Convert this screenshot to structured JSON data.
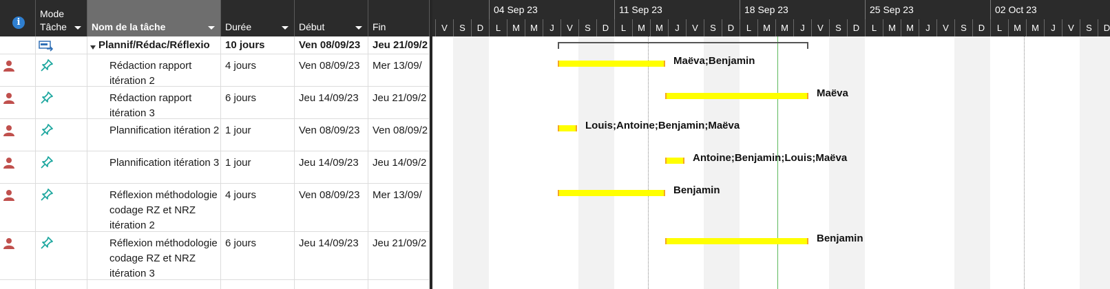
{
  "headers": {
    "mode_line1": "Mode",
    "mode_line2": "Tâche",
    "name": "Nom de la tâche",
    "duration": "Durée",
    "start": "Début",
    "end": "Fin"
  },
  "timeline": {
    "weeks": [
      "04 Sep 23",
      "11 Sep 23",
      "18 Sep 23",
      "25 Sep 23",
      "02 Oct 23"
    ],
    "days": [
      "V",
      "S",
      "D",
      "L",
      "M",
      "M",
      "J",
      "V",
      "S",
      "D",
      "L",
      "M",
      "M",
      "J",
      "V",
      "S",
      "D",
      "L",
      "M",
      "M",
      "J",
      "V",
      "S",
      "D",
      "L",
      "M",
      "M",
      "J",
      "V",
      "S",
      "D",
      "L",
      "M",
      "M",
      "J",
      "V",
      "S",
      "D"
    ]
  },
  "summary": {
    "name": "Plannif/Rédac/Réflexio",
    "duration": "10 jours",
    "start": "Ven 08/09/23",
    "end": "Jeu 21/09/2"
  },
  "tasks": [
    {
      "name": "Rédaction rapport itération 2",
      "duration": "4 jours",
      "start": "Ven 08/09/23",
      "end": "Mer 13/09/",
      "resources": "Maëva;Benjamin"
    },
    {
      "name": "Rédaction rapport itération 3",
      "duration": "6 jours",
      "start": "Jeu 14/09/23",
      "end": "Jeu 21/09/2",
      "resources": "Maëva"
    },
    {
      "name": "Plannification itération 2",
      "duration": "1 jour",
      "start": "Ven 08/09/23",
      "end": "Ven 08/09/2",
      "resources": "Louis;Antoine;Benjamin;Maëva"
    },
    {
      "name": "Plannification itération 3",
      "duration": "1 jour",
      "start": "Jeu 14/09/23",
      "end": "Jeu 14/09/2",
      "resources": "Antoine;Benjamin;Louis;Maëva"
    },
    {
      "name": "Réflexion méthodologie codage RZ et NRZ itération 2",
      "duration": "4 jours",
      "start": "Ven 08/09/23",
      "end": "Mer 13/09/",
      "resources": "Benjamin"
    },
    {
      "name": "Réflexion méthodologie codage RZ et NRZ itération 3",
      "duration": "6 jours",
      "start": "Jeu 14/09/23",
      "end": "Jeu 21/09/2",
      "resources": "Benjamin"
    }
  ],
  "colors": {
    "header_bg": "#2b2b2b",
    "selected_header": "#6e6e6e",
    "bar_fill": "#ffff00",
    "bar_edge": "#f5a623",
    "today_line": "#5cb85c",
    "person_icon": "#c0504d",
    "pin_icon": "#20a8a0"
  }
}
